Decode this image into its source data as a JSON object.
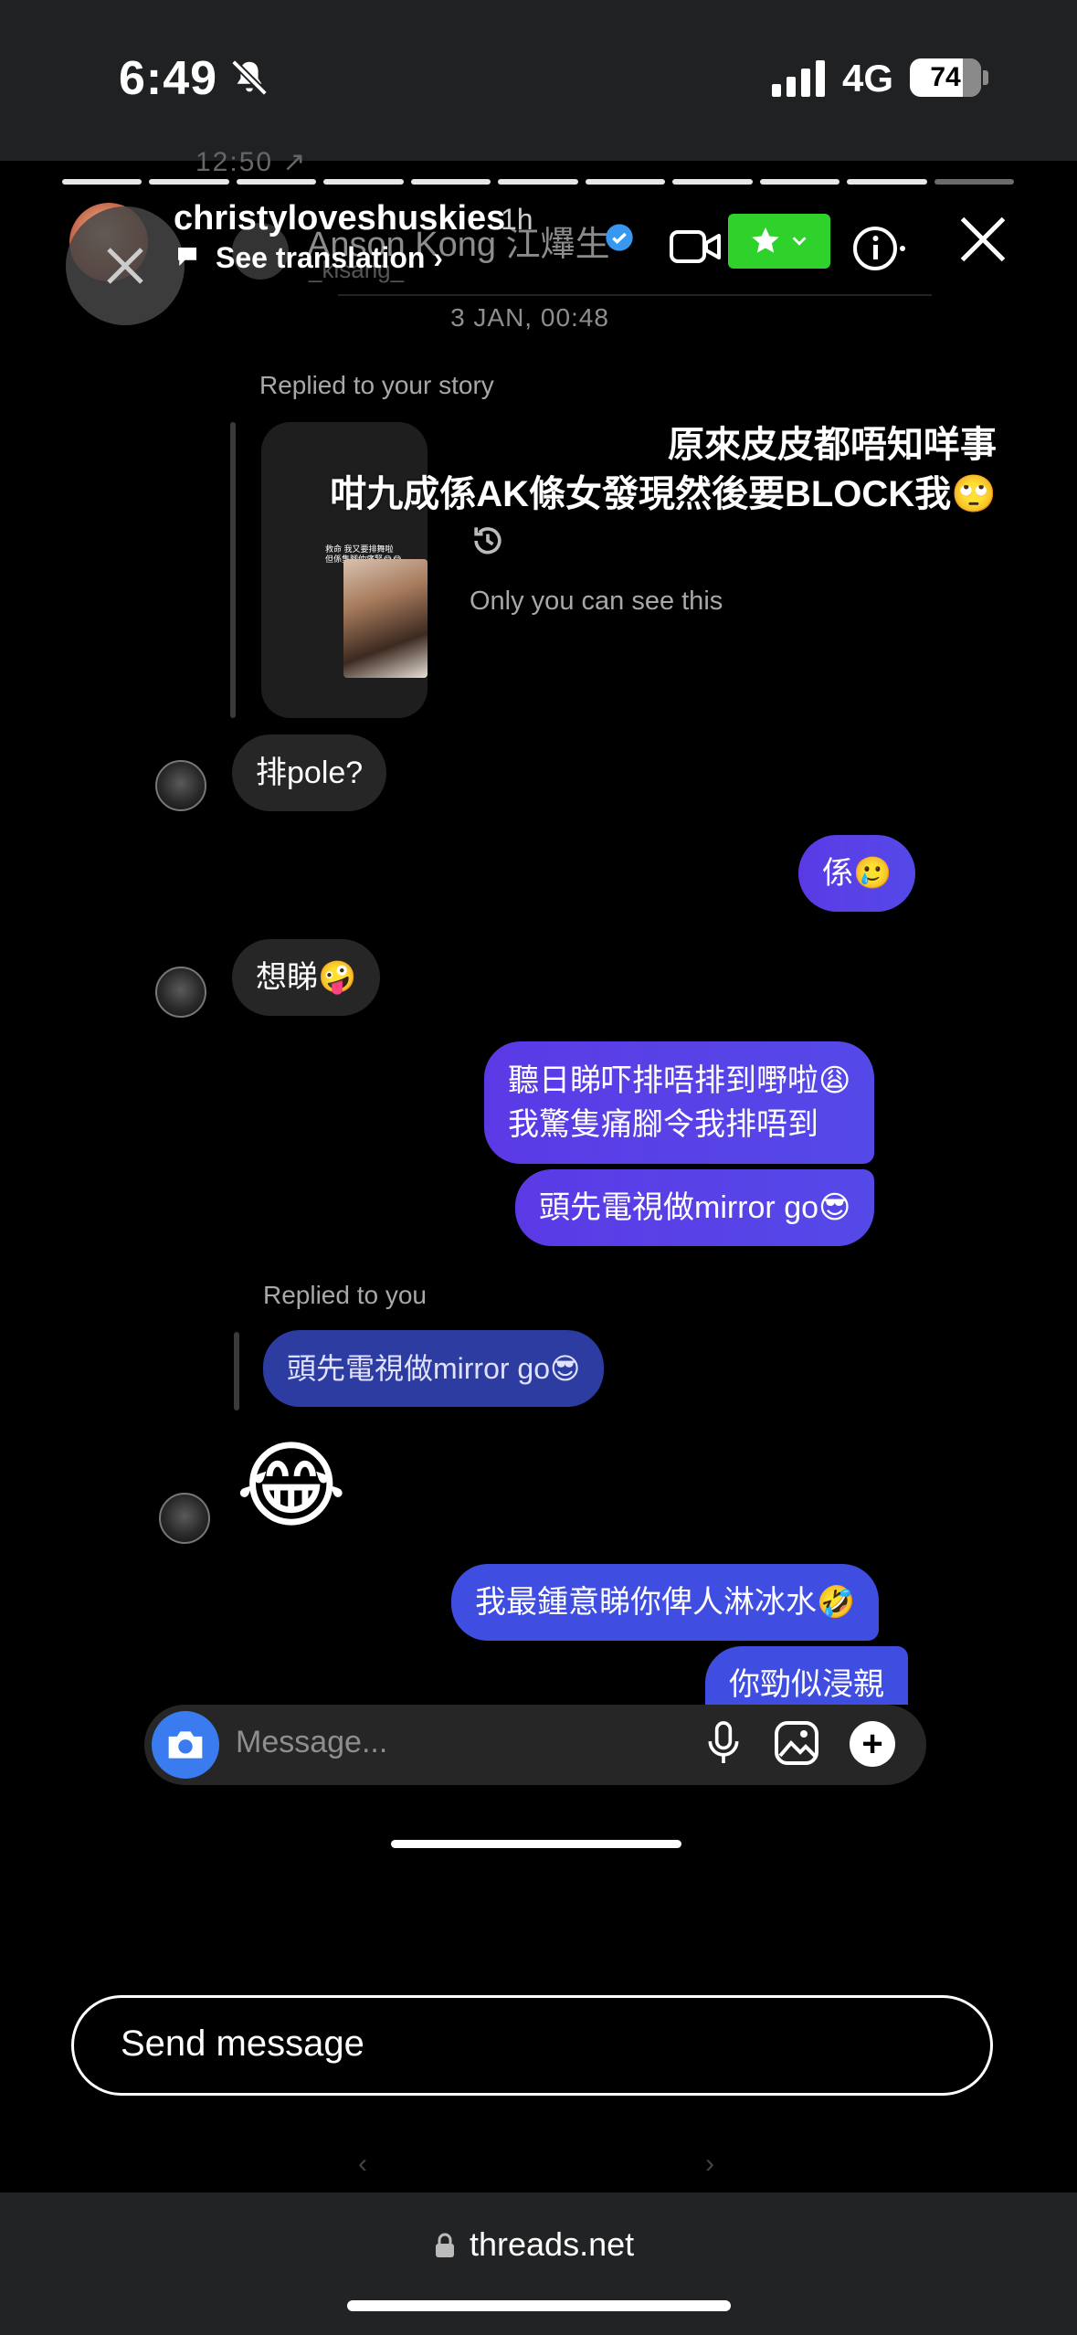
{
  "status_bar": {
    "time": "6:49",
    "network": "4G",
    "battery": "74"
  },
  "story": {
    "ghost_time": "12:50 ↗",
    "user": "christyloveshuskies",
    "age": "1h",
    "see_translation": "See translation",
    "reply_placeholder": "Send message"
  },
  "dm": {
    "contact_name": "Anson Kong 江𤒹生",
    "contact_handle": "_kisang_",
    "date": "3 JAN, 00:48",
    "replied_story_label": "Replied to your story",
    "story_overlay_line1": "原來皮皮都唔知咩事",
    "story_overlay_line2": "咁九成係AK條女發現然後要BLOCK我🙄",
    "thumb_caption": "救命 我又要排舞啦\n但係隻腳仲痛緊😂😂",
    "only_you": "Only you can see this",
    "messages": [
      {
        "from": "in",
        "text": "排pole?"
      },
      {
        "from": "out",
        "text": "係🥲"
      },
      {
        "from": "in",
        "text": "想睇🤪"
      },
      {
        "from": "out",
        "text": "聽日睇吓排唔排到嘢啦😩"
      },
      {
        "from": "out",
        "text": "我驚隻痛腳令我排唔到"
      },
      {
        "from": "out",
        "text": "頭先電視做mirror go😎"
      },
      {
        "from": "in",
        "text": "😂"
      },
      {
        "from": "out",
        "text": "我最鍾意睇你俾人淋冰水🤣"
      },
      {
        "from": "out",
        "text": "你勁似浸親"
      }
    ],
    "replied_you_label": "Replied to you",
    "quoted_text": "頭先電視做mirror go😎",
    "composer_placeholder": "Message..."
  },
  "browser": {
    "url": "threads.net"
  },
  "colors": {
    "accent": "#5549e8",
    "star_green": "#2fd12b",
    "camera_blue": "#3a7cf0"
  }
}
